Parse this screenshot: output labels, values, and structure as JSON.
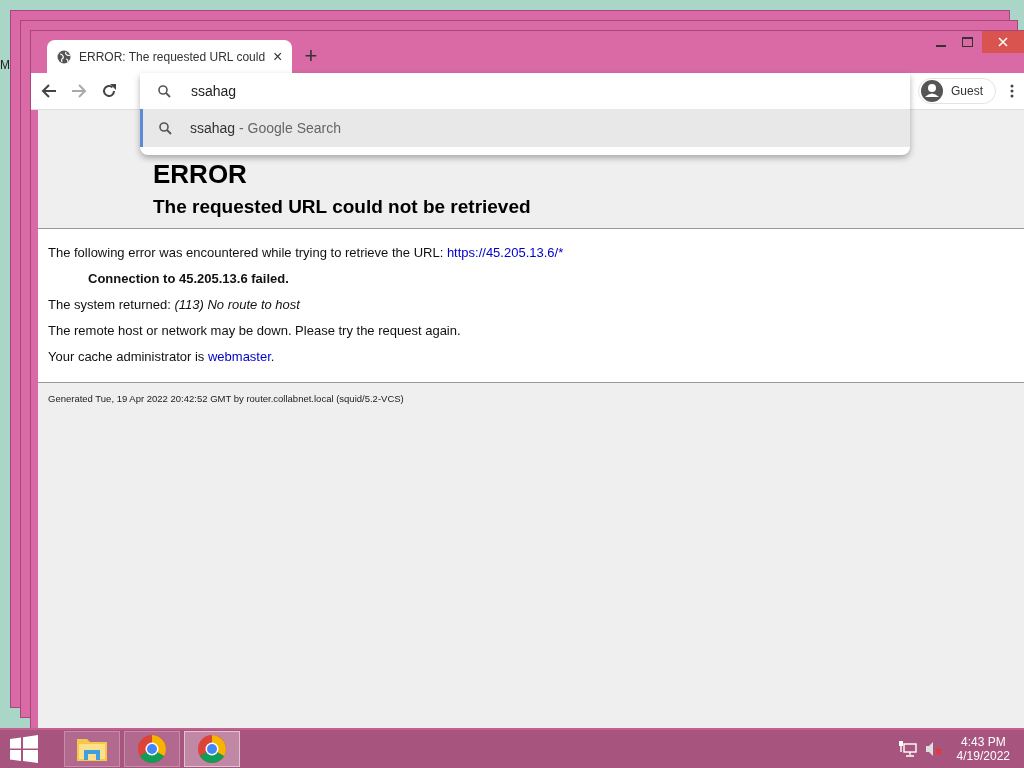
{
  "desktop": {
    "label": "M"
  },
  "browser": {
    "tab": {
      "title": "ERROR: The requested URL could",
      "close": "×"
    },
    "new_tab": "+",
    "omnibox": {
      "value": "ssahag"
    },
    "suggestions": [
      {
        "query": "ssahag",
        "suffix": "- Google Search",
        "selected": true
      }
    ],
    "profile": {
      "label": "Guest"
    }
  },
  "page": {
    "heading": "ERROR",
    "subheading": "The requested URL could not be retrieved",
    "error_intro": {
      "text": "The following error was encountered while trying to retrieve the URL:",
      "link": "https://45.205.13.6/*"
    },
    "error_detail": "Connection to 45.205.13.6 failed.",
    "system_returned": "The system returned: *(113) No route to host*",
    "advice": "The remote host or network may be down. Please try the request again.",
    "admin": {
      "text": "Your cache administrator is",
      "link": "webmaster",
      "after": "."
    },
    "footer": "Generated Tue, 19 Apr 2022 20:42:52 GMT by router.collabnet.local (squid/5.2-VCS)"
  },
  "taskbar": {
    "apps": [
      {
        "kind": "explorer",
        "selected": false
      },
      {
        "kind": "chrome",
        "selected": false
      },
      {
        "kind": "chrome",
        "selected": true
      }
    ],
    "volume": {
      "muted": true
    },
    "time": "4:43 PM",
    "date": "4/19/2022"
  }
}
